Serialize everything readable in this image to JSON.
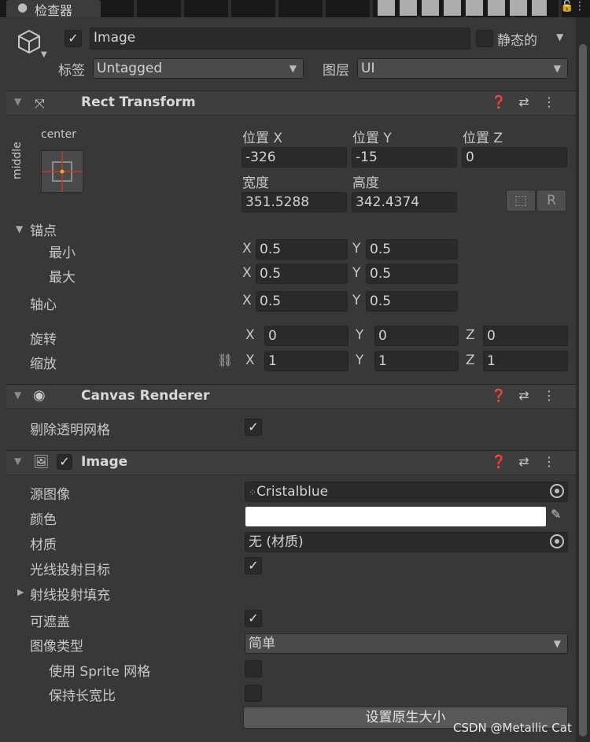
{
  "tab": {
    "icon": "info-icon",
    "label": "检查器"
  },
  "object": {
    "enabled": true,
    "name": "Image",
    "static_label": "静态的",
    "tag_label": "标签",
    "tag_value": "Untagged",
    "layer_label": "图层",
    "layer_value": "UI"
  },
  "rect_transform": {
    "title": "Rect Transform",
    "anchor_preset": {
      "horizontal": "center",
      "vertical": "middle"
    },
    "pos_x_label": "位置 X",
    "pos_y_label": "位置 Y",
    "pos_z_label": "位置 Z",
    "pos_x": "-326",
    "pos_y": "-15",
    "pos_z": "0",
    "width_label": "宽度",
    "height_label": "高度",
    "width": "351.5288",
    "height": "342.4374",
    "r_button": "R",
    "anchors_label": "锚点",
    "min_label": "最小",
    "max_label": "最大",
    "pivot_label": "轴心",
    "min_x": "0.5",
    "min_y": "0.5",
    "max_x": "0.5",
    "max_y": "0.5",
    "pivot_x": "0.5",
    "pivot_y": "0.5",
    "rotation_label": "旋转",
    "scale_label": "缩放",
    "rot_x": "0",
    "rot_y": "0",
    "rot_z": "0",
    "scale_x": "1",
    "scale_y": "1",
    "scale_z": "1",
    "axis_x": "X",
    "axis_y": "Y",
    "axis_z": "Z"
  },
  "canvas_renderer": {
    "title": "Canvas Renderer",
    "cull_label": "剔除透明网格",
    "cull_checked": true
  },
  "image": {
    "title": "Image",
    "enabled": true,
    "source_label": "源图像",
    "source_value": "Cristalblue",
    "color_label": "颜色",
    "color_value": "#ffffff",
    "material_label": "材质",
    "material_value": "无 (材质)",
    "raycast_label": "光线投射目标",
    "raycast_checked": true,
    "padding_label": "射线投射填充",
    "maskable_label": "可遮盖",
    "maskable_checked": true,
    "type_label": "图像类型",
    "type_value": "简单",
    "use_sprite_mesh_label": "使用 Sprite 网格",
    "use_sprite_mesh_checked": false,
    "preserve_aspect_label": "保持长宽比",
    "preserve_aspect_checked": false,
    "native_size_button": "设置原生大小"
  },
  "watermark": "CSDN @Metallic Cat",
  "colors": {
    "bg": "#383838",
    "field": "#2a2a2a",
    "header": "#3e3e3e",
    "anchor_red": "#c0392b",
    "anchor_yellow": "#e0b020"
  }
}
